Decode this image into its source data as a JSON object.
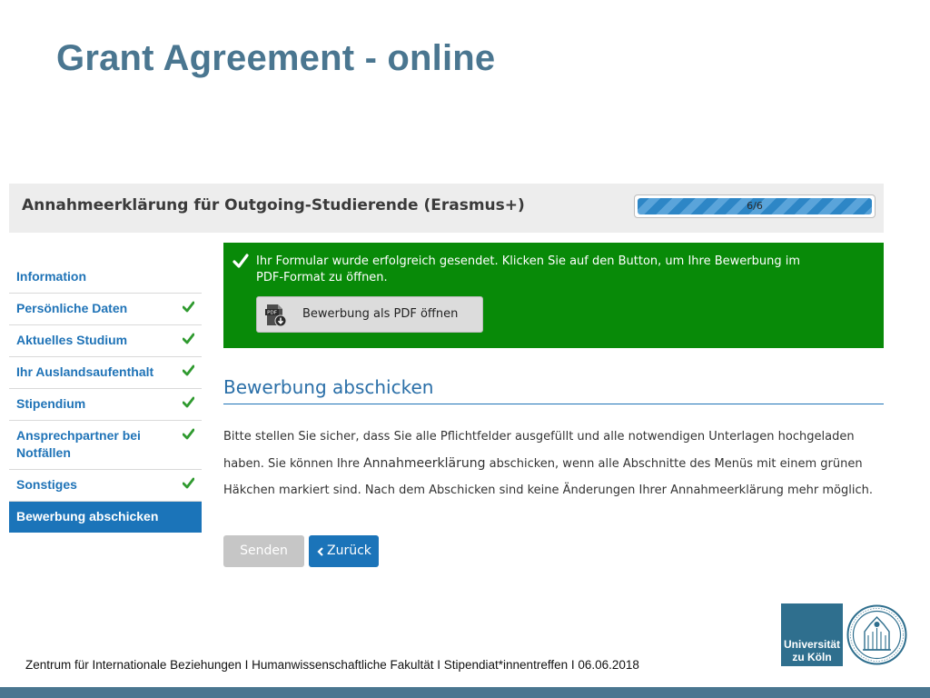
{
  "slide": {
    "title": "Grant Agreement - online",
    "footer": "Zentrum für Internationale Beziehungen I Humanwissenschaftliche Fakultät I Stipendiat*innentreffen I 06.06.2018"
  },
  "app": {
    "title": "Annahmeerklärung für Outgoing-Studierende (Erasmus+)",
    "progress": {
      "label": "6/6",
      "current": 6,
      "total": 6
    }
  },
  "sidebar": {
    "items": [
      {
        "label": "Information",
        "done": false
      },
      {
        "label": "Persönliche Daten",
        "done": true
      },
      {
        "label": "Aktuelles Studium",
        "done": true
      },
      {
        "label": "Ihr Auslandsaufenthalt",
        "done": true
      },
      {
        "label": "Stipendium",
        "done": true
      },
      {
        "label": "Ansprechpartner bei Notfällen",
        "done": true
      },
      {
        "label": "Sonstiges",
        "done": true
      },
      {
        "label": "Bewerbung abschicken",
        "active": true
      }
    ]
  },
  "success": {
    "message": "Ihr Formular wurde erfolgreich gesendet. Klicken Sie auf den Button, um Ihre Bewerbung im PDF-Format zu öffnen.",
    "pdf_button": "Bewerbung als PDF öffnen",
    "pdf_icon_text": "PDF"
  },
  "section": {
    "heading": "Bewerbung abschicken",
    "text_before": "Bitte stellen Sie sicher, dass Sie alle Pflichtfelder ausgefüllt und alle notwendigen Unterlagen hochgeladen haben. Sie können Ihre ",
    "text_emphasis": "Annahmeerklärung",
    "text_after": " abschicken, wenn alle Abschnitte des Menüs mit einem grünen Häkchen markiert sind. Nach dem Abschicken sind keine Änderungen Ihrer Annahmeerklärung mehr möglich."
  },
  "buttons": {
    "send": "Senden",
    "back": "Zurück"
  },
  "logo": {
    "line1": "Universität",
    "line2": "zu Köln"
  },
  "colors": {
    "title": "#4a7690",
    "accent": "#1b74b9",
    "success": "#088a08",
    "check": "#2f9a2f"
  }
}
